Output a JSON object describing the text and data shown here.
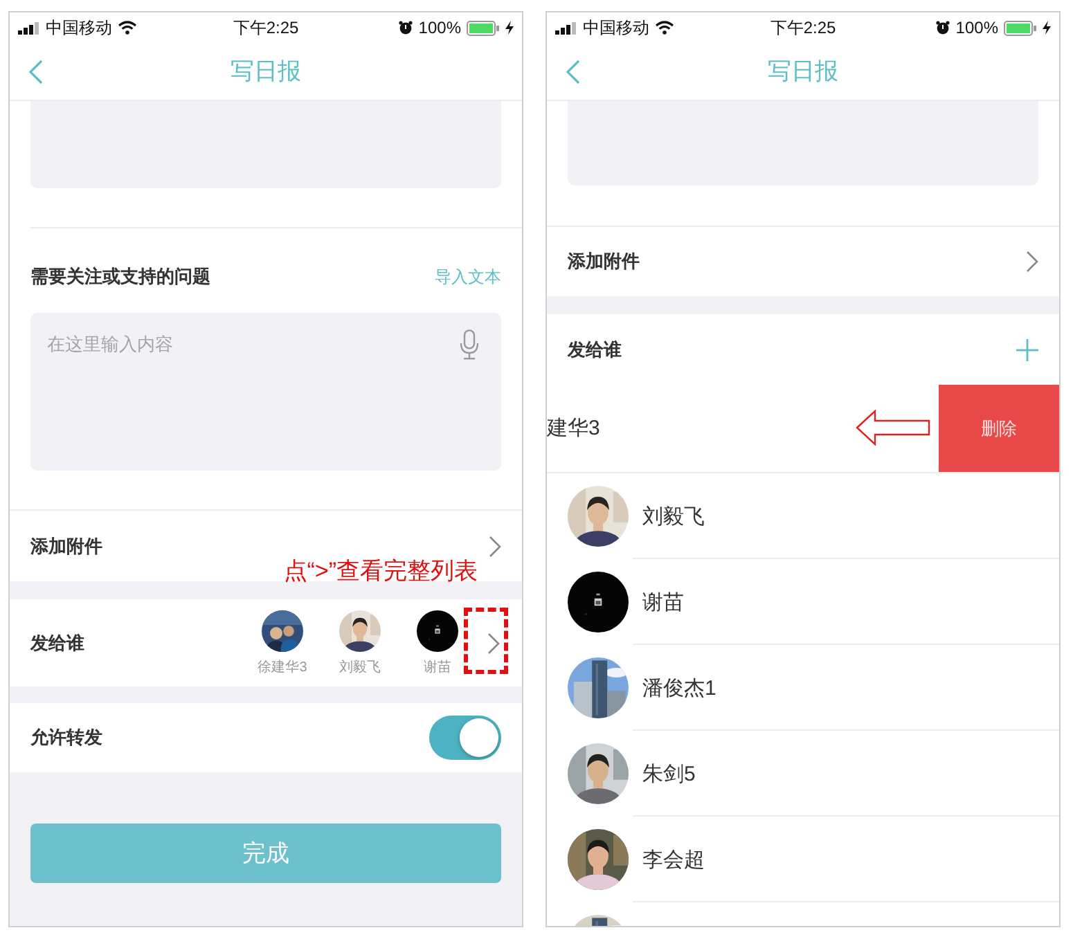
{
  "left_screen": {
    "status_bar": {
      "carrier": "中国移动",
      "time": "下午2:25",
      "battery": "100%"
    },
    "title": "写日报",
    "issue_section": {
      "label": "需要关注或支持的问题",
      "link": "导入文本",
      "placeholder": "在这里输入内容"
    },
    "attachment_row": {
      "label": "添加附件"
    },
    "recipients_row": {
      "label": "发给谁",
      "recipients": [
        {
          "name": "徐建华3"
        },
        {
          "name": "刘毅飞"
        },
        {
          "name": "谢苗"
        }
      ]
    },
    "forward_row": {
      "label": "允许转发",
      "on": true
    },
    "done_button": "完成",
    "annotation": "点“>”查看完整列表"
  },
  "right_screen": {
    "status_bar": {
      "carrier": "中国移动",
      "time": "下午2:25",
      "battery": "100%"
    },
    "title": "写日报",
    "attachment_row": {
      "label": "添加附件"
    },
    "recipients_header": {
      "label": "发给谁"
    },
    "swiped_row": {
      "name": "建华3",
      "action": "删除"
    },
    "recipients": [
      {
        "kind": "contact",
        "name": "刘毅飞"
      },
      {
        "kind": "contact",
        "name": "谢苗"
      },
      {
        "kind": "contact",
        "name": "潘俊杰1"
      },
      {
        "kind": "contact",
        "name": "朱剑5"
      },
      {
        "kind": "contact",
        "name": "李会超"
      },
      {
        "kind": "picture"
      }
    ]
  }
}
